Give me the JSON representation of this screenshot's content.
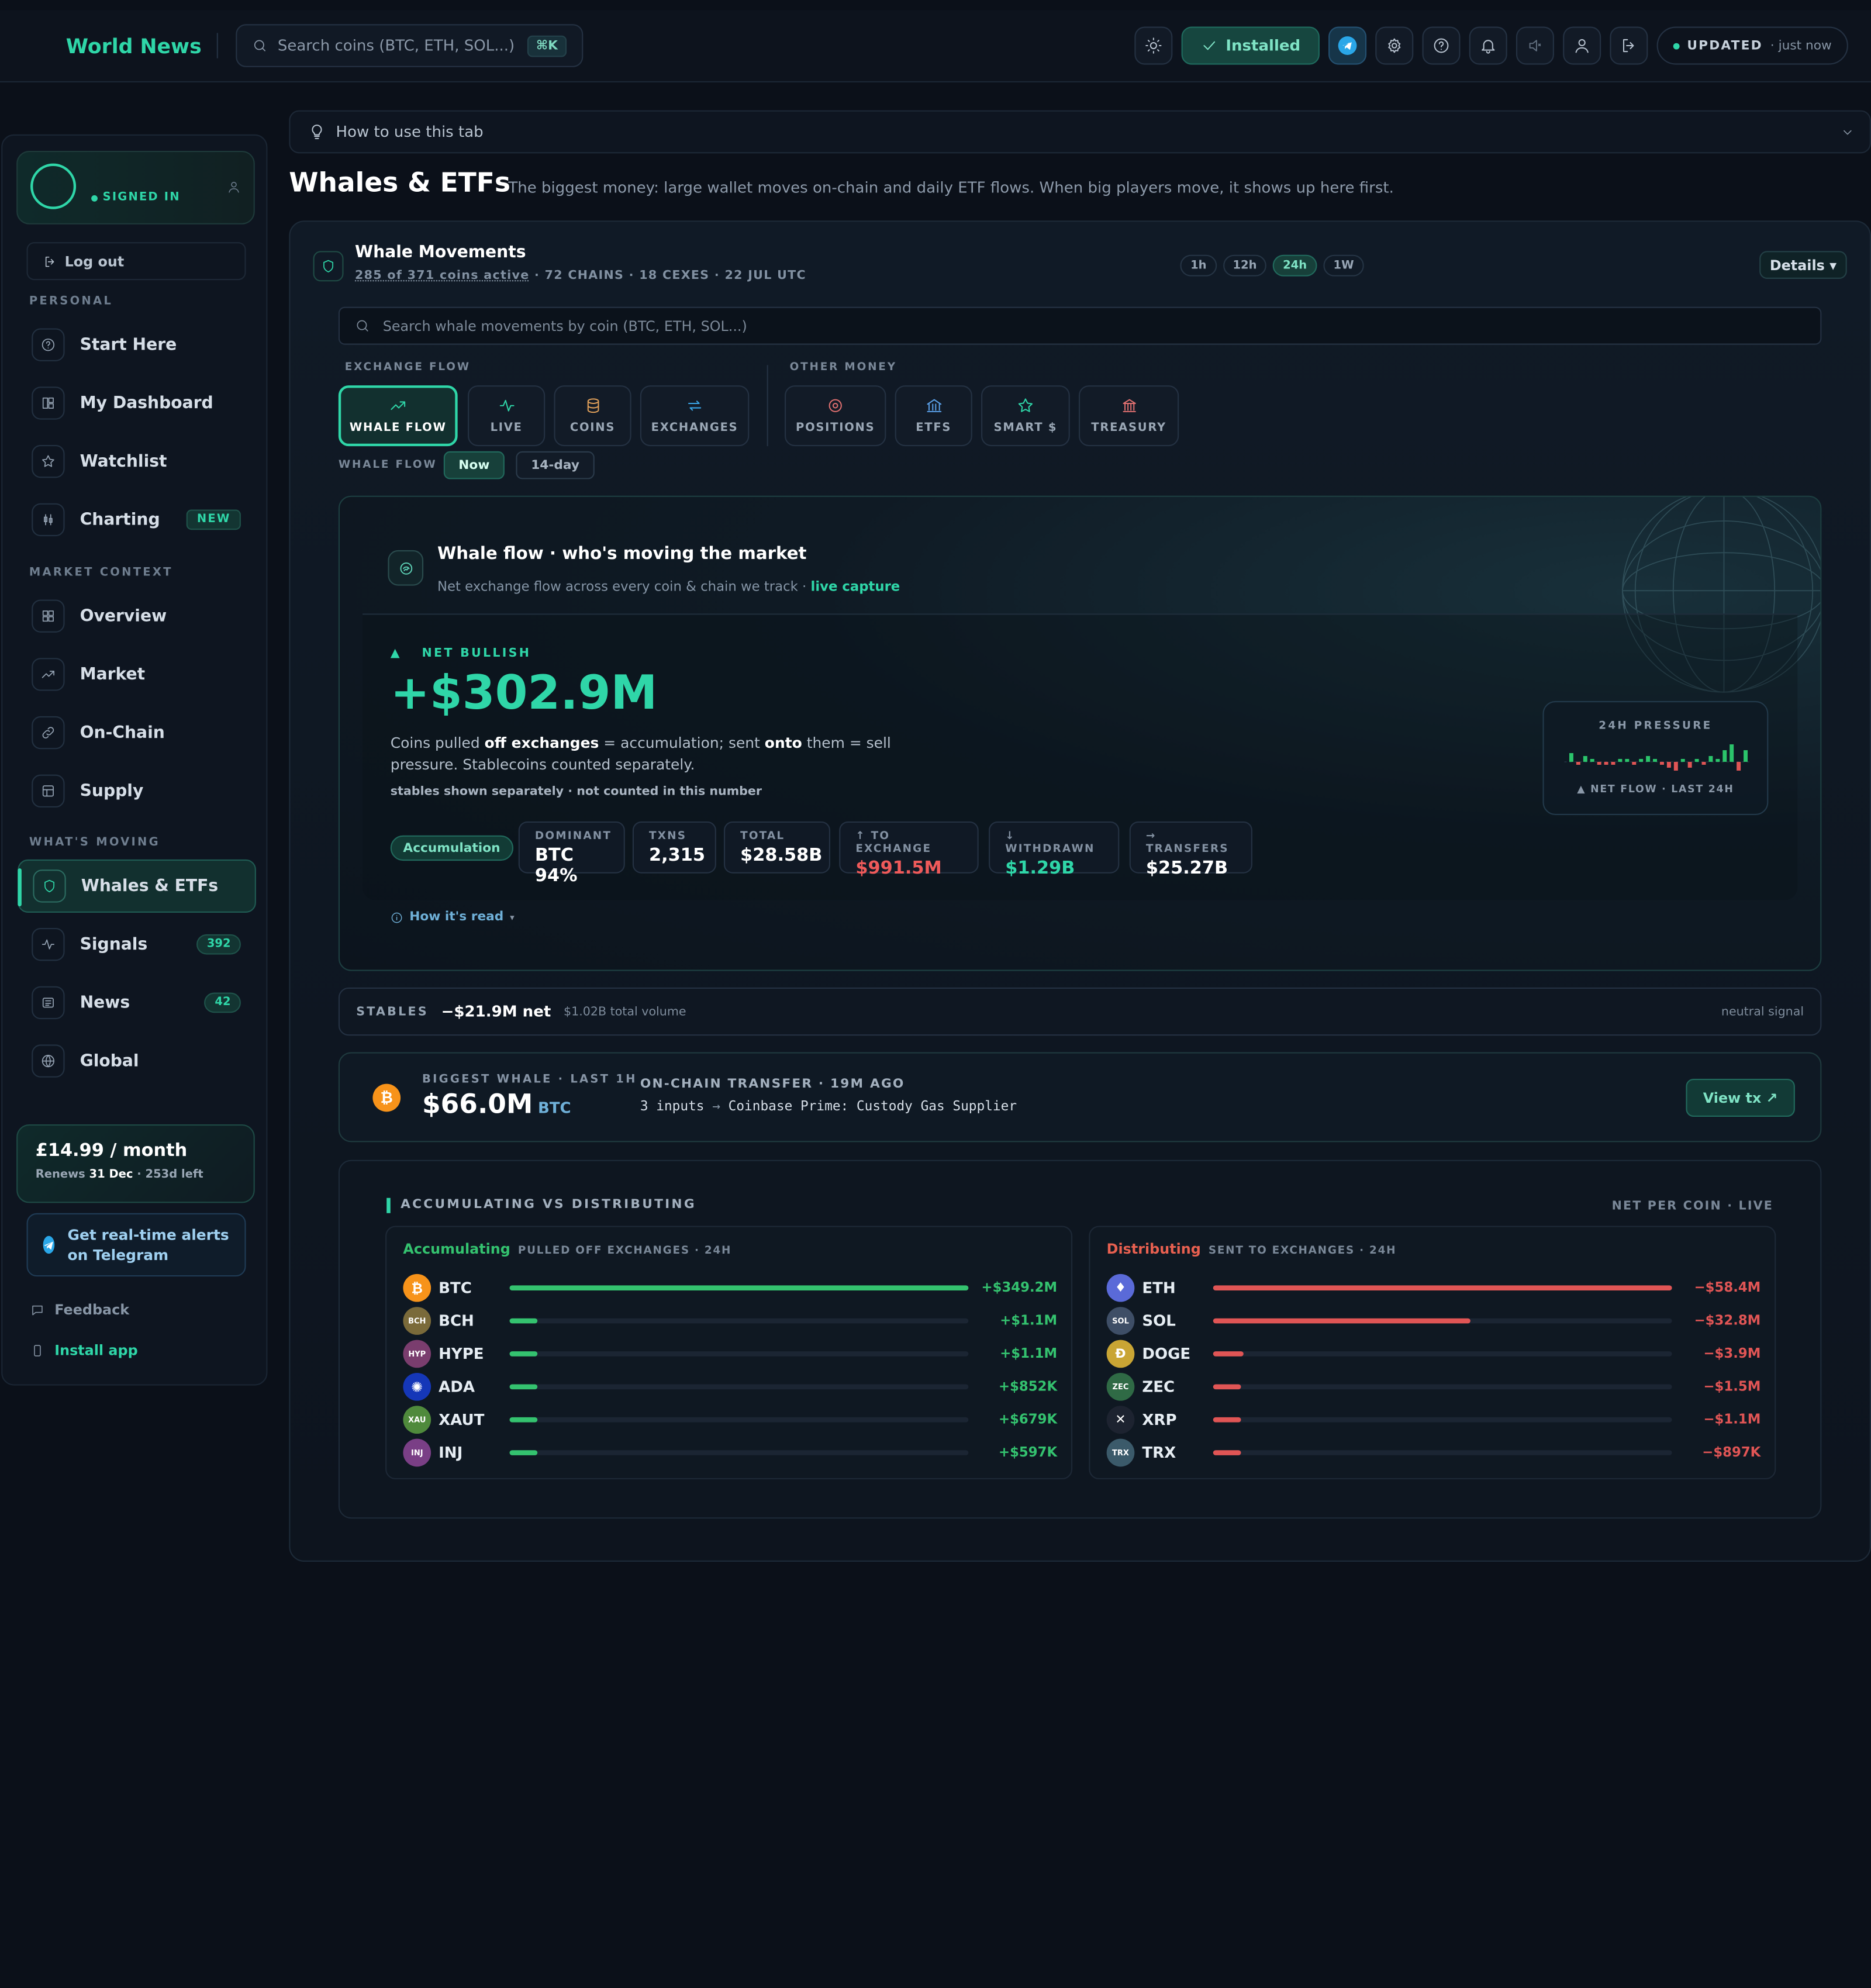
{
  "topbar": {
    "brand": "World News",
    "search_placeholder": "Search coins (BTC, ETH, SOL...)",
    "shortcut": "⌘K",
    "installed_label": "Installed",
    "updated_label": "UPDATED",
    "updated_time": "· just now"
  },
  "sidebar": {
    "profile_status": "SIGNED IN",
    "logout_label": "Log out",
    "sections": {
      "personal": "PERSONAL",
      "market_context": "MARKET CONTEXT",
      "whats_moving": "WHAT'S MOVING"
    },
    "items": [
      {
        "label": "Start Here",
        "icon": "help-circle-icon"
      },
      {
        "label": "My Dashboard",
        "icon": "dashboard-icon"
      },
      {
        "label": "Watchlist",
        "icon": "star-icon"
      },
      {
        "label": "Charting",
        "icon": "candles-icon",
        "badge": "NEW"
      },
      {
        "label": "Overview",
        "icon": "grid-icon"
      },
      {
        "label": "Market",
        "icon": "trend-icon"
      },
      {
        "label": "On-Chain",
        "icon": "link-icon"
      },
      {
        "label": "Supply",
        "icon": "layout-icon"
      },
      {
        "label": "Whales & ETFs",
        "icon": "shield-icon",
        "active": true
      },
      {
        "label": "Signals",
        "icon": "pulse-icon",
        "badge": "392"
      },
      {
        "label": "News",
        "icon": "newspaper-icon",
        "badge": "42"
      },
      {
        "label": "Global",
        "icon": "globe-icon"
      }
    ],
    "plan_price": "£14.99 / month",
    "plan_renew_prefix": "Renews ",
    "plan_renew_date": "31 Dec",
    "plan_renew_suffix": " · 253d left",
    "telegram_cta": "Get real-time alerts on Telegram",
    "feedback": "Feedback",
    "install": "Install app"
  },
  "howto": "How to use this tab",
  "page": {
    "title": "Whales & ETFs",
    "subtitle": "The biggest money: large wallet moves on-chain and daily ETF flows. When big players move, it shows up here first."
  },
  "whale": {
    "title": "Whale Movements",
    "meta_active": "285 of 371 coins active",
    "meta_rest": " · 72 CHAINS · 18 CEXES · 22 JUL UTC",
    "timeframes": [
      "1h",
      "12h",
      "24h",
      "1W"
    ],
    "timeframe_selected": "24h",
    "details_label": "Details ▾",
    "search_placeholder": "Search whale movements by coin (BTC, ETH, SOL...)",
    "group_exchange": "EXCHANGE FLOW",
    "group_other": "OTHER MONEY",
    "categories": [
      "WHALE FLOW",
      "LIVE",
      "COINS",
      "EXCHANGES",
      "POSITIONS",
      "ETFS",
      "SMART $",
      "TREASURY"
    ],
    "flow_label": "WHALE FLOW",
    "flow_modes": [
      "Now",
      "14-day"
    ]
  },
  "hero": {
    "title": "Whale flow · who's moving the market",
    "subtitle": "Net exchange flow across every coin & chain we track ·",
    "subtitle_live": "live capture",
    "direction": "NET BULLISH",
    "direction_arrow": "▲",
    "net_value": "+$302.9M",
    "desc_1": "Coins pulled ",
    "desc_2": "off exchanges",
    "desc_3": " = accumulation; sent ",
    "desc_4": "onto",
    "desc_5": " them = sell pressure. Stablecoins counted separately.",
    "note": "stables shown separately · not counted in this number",
    "badge": "Accumulation",
    "stats": [
      {
        "label": "DOMINANT",
        "value": "BTC 94%"
      },
      {
        "label": "TXNS",
        "value": "2,315"
      },
      {
        "label": "TOTAL",
        "value": "$28.58B"
      },
      {
        "label": "↑ TO EXCHANGE",
        "value": "$991.5M"
      },
      {
        "label": "↓ WITHDRAWN",
        "value": "$1.29B"
      },
      {
        "label": "→ TRANSFERS",
        "value": "$25.27B"
      }
    ],
    "how_read": "How it's read",
    "pressure_label": "24H PRESSURE",
    "pressure_caption": "▲ NET FLOW · LAST 24H",
    "pressure_bars": [
      3,
      -1,
      2,
      1,
      -1,
      -1,
      -1,
      1,
      1,
      -1,
      1,
      2,
      1,
      -1,
      -2,
      -3,
      1,
      -2,
      1,
      -1,
      2,
      1,
      4,
      6,
      -3,
      4
    ],
    "colors": {
      "up": "#2bc46b",
      "down": "#e05555"
    }
  },
  "stables": {
    "label": "STABLES",
    "net": "−$21.9M net",
    "volume": "$1.02B total volume",
    "signal": "neutral signal"
  },
  "biggest": {
    "coin_glyph": "₿",
    "label": "BIGGEST WHALE · LAST 1H",
    "amount": "$66.0M",
    "asset": "BTC",
    "tx_label": "ON-CHAIN TRANSFER · 19M AGO",
    "tx_from": "3 inputs",
    "tx_arrow": "→",
    "tx_to": "Coinbase Prime: Custody Gas Supplier",
    "view_label": "View tx ↗"
  },
  "avd": {
    "title": "ACCUMULATING VS DISTRIBUTING",
    "right_label": "NET PER COIN · LIVE",
    "acc_title": "Accumulating",
    "acc_sub": "PULLED OFF EXCHANGES · 24H",
    "dist_title": "Distributing",
    "dist_sub": "SENT TO EXCHANGES · 24H",
    "accumulating": [
      {
        "sym": "BTC",
        "glyph": "₿",
        "bg": "#f7931a",
        "fsize": 11,
        "value": "+$349.2M",
        "amount": 349.2
      },
      {
        "sym": "BCH",
        "glyph": "BCH",
        "bg": "#7a6a3a",
        "fsize": 6,
        "value": "+$1.1M",
        "amount": 1.1
      },
      {
        "sym": "HYPE",
        "glyph": "HYP",
        "bg": "#7a3d6e",
        "fsize": 6,
        "value": "+$1.1M",
        "amount": 1.1
      },
      {
        "sym": "ADA",
        "glyph": "✺",
        "bg": "#1537b8",
        "fsize": 11,
        "value": "+$852K",
        "amount": 0.852
      },
      {
        "sym": "XAUT",
        "glyph": "XAU",
        "bg": "#4f8a3c",
        "fsize": 6,
        "value": "+$679K",
        "amount": 0.679
      },
      {
        "sym": "INJ",
        "glyph": "INJ",
        "bg": "#7a3f86",
        "fsize": 6,
        "value": "+$597K",
        "amount": 0.597
      }
    ],
    "distributing": [
      {
        "sym": "ETH",
        "glyph": "♦",
        "bg": "#5a6ad8",
        "fsize": 10,
        "value": "−$58.4M",
        "amount": 58.4
      },
      {
        "sym": "SOL",
        "glyph": "SOL",
        "bg": "#3e4e66",
        "fsize": 6,
        "value": "−$32.8M",
        "amount": 32.8
      },
      {
        "sym": "DOGE",
        "glyph": "Ð",
        "bg": "#c9a534",
        "fsize": 10,
        "value": "−$3.9M",
        "amount": 3.9
      },
      {
        "sym": "ZEC",
        "glyph": "ZEC",
        "bg": "#2f6a45",
        "fsize": 6,
        "value": "−$1.5M",
        "amount": 1.5
      },
      {
        "sym": "XRP",
        "glyph": "✕",
        "bg": "#1d2330",
        "fsize": 10,
        "value": "−$1.1M",
        "amount": 1.1
      },
      {
        "sym": "TRX",
        "glyph": "TRX",
        "bg": "#3b5a6a",
        "fsize": 6,
        "value": "−$897K",
        "amount": 0.897
      }
    ],
    "colors": {
      "acc": "#34c26f",
      "dist": "#e05555"
    }
  }
}
